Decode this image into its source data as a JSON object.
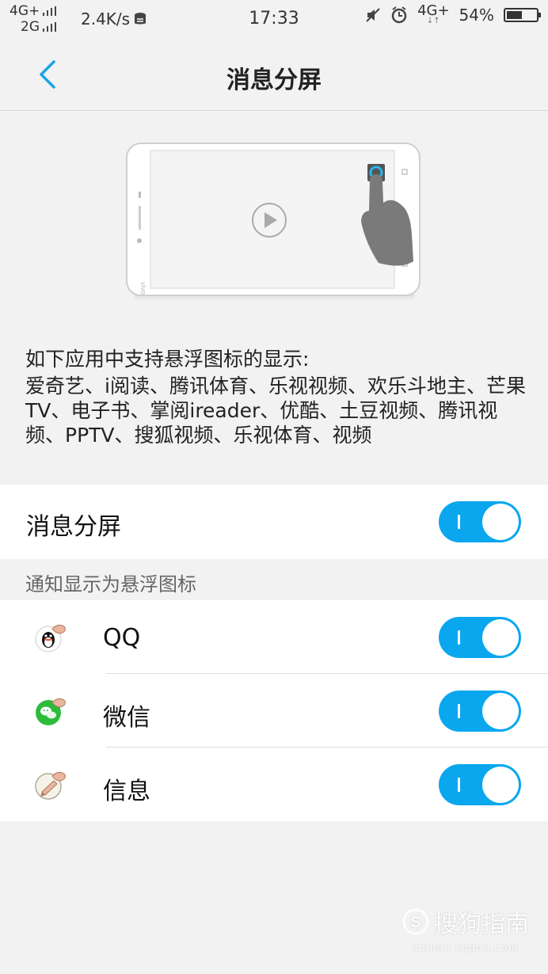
{
  "status_bar": {
    "net_top": "4G+",
    "net_bottom": "2G",
    "speed": "2.4K/s",
    "time": "17:33",
    "net_right": "4G+",
    "battery": "54%",
    "battery_level": 0.54
  },
  "nav": {
    "title": "消息分屏"
  },
  "description": {
    "heading": "如下应用中支持悬浮图标的显示:",
    "body": "爱奇艺、i阅读、腾讯体育、乐视视频、欢乐斗地主、芒果TV、电子书、掌阅ireader、优酷、土豆视频、腾讯视频、PPTV、搜狐视频、乐视体育、视频"
  },
  "main_switch": {
    "label": "消息分屏",
    "on": true
  },
  "section": {
    "header": "通知显示为悬浮图标"
  },
  "apps": [
    {
      "label": "QQ",
      "icon": "qq-icon",
      "on": true
    },
    {
      "label": "微信",
      "icon": "wechat-icon",
      "on": true
    },
    {
      "label": "信息",
      "icon": "messages-icon",
      "on": true
    }
  ],
  "watermark": {
    "main": "搜狗指南",
    "sub": "zhinan.sogou.com"
  },
  "colors": {
    "accent": "#0aa7ee",
    "background": "#f2f2f2",
    "card": "#ffffff"
  }
}
